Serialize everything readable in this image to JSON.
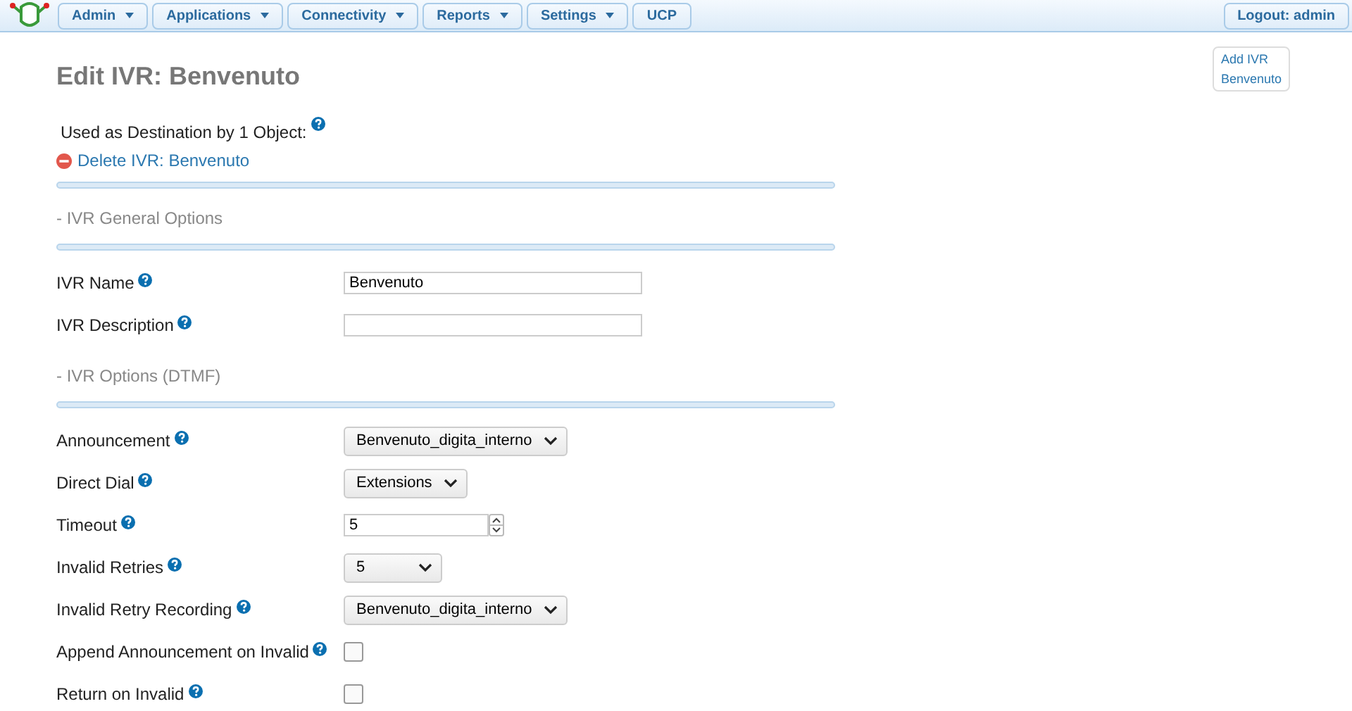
{
  "nav": {
    "menus": [
      {
        "label": "Admin",
        "dropdown": true
      },
      {
        "label": "Applications",
        "dropdown": true
      },
      {
        "label": "Connectivity",
        "dropdown": true
      },
      {
        "label": "Reports",
        "dropdown": true
      },
      {
        "label": "Settings",
        "dropdown": true
      },
      {
        "label": "UCP",
        "dropdown": false
      }
    ],
    "logout": "Logout: admin"
  },
  "title": "Edit IVR: Benvenuto",
  "usage": "Used as Destination by 1 Object:",
  "delete_link": "Delete IVR: Benvenuto",
  "side_panel": [
    "Add IVR",
    "Benvenuto"
  ],
  "sections": [
    {
      "heading": "- IVR General Options",
      "fields": [
        {
          "kind": "text",
          "label": "IVR Name",
          "value": "Benvenuto"
        },
        {
          "kind": "text",
          "label": "IVR Description"
        }
      ]
    },
    {
      "heading": "- IVR Options (DTMF)",
      "fields": [
        {
          "kind": "select",
          "label": "Announcement",
          "value": "Benvenuto_digita_interno"
        },
        {
          "kind": "select",
          "label": "Direct Dial",
          "value": "Extensions"
        },
        {
          "kind": "number",
          "label": "Timeout",
          "value": "5"
        },
        {
          "kind": "select",
          "label": "Invalid Retries",
          "value": "5"
        },
        {
          "kind": "select",
          "label": "Invalid Retry Recording",
          "value": "Benvenuto_digita_interno"
        },
        {
          "kind": "checkbox",
          "label": "Append Announcement on Invalid",
          "checked": false
        },
        {
          "kind": "checkbox",
          "label": "Return on Invalid",
          "checked": false
        }
      ]
    }
  ]
}
